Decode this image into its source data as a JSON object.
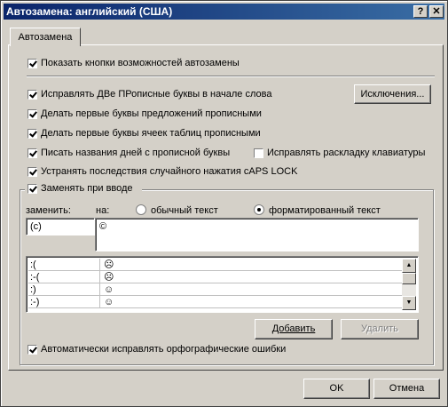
{
  "window": {
    "title": "Автозамена: английский (США)",
    "help_label": "?",
    "close_label": "✕"
  },
  "tabs": [
    {
      "label": "Автозамена",
      "selected": true
    }
  ],
  "options": {
    "show_buttons": {
      "label": "Показать кнопки возможностей автозамены",
      "checked": true
    },
    "two_initial_caps": {
      "label": "Исправлять ДВе ПРописные буквы в начале слова",
      "checked": true
    },
    "capitalize_sentences": {
      "label": "Делать первые буквы предложений прописными",
      "checked": true
    },
    "capitalize_table_cells": {
      "label": "Делать первые буквы ячеек таблиц прописными",
      "checked": true
    },
    "capitalize_day_names": {
      "label": "Писать названия дней с прописной буквы",
      "checked": true
    },
    "fix_keyboard_layout": {
      "label": "Исправлять раскладку клавиатуры",
      "checked": false
    },
    "caps_lock": {
      "label": "Устранять последствия случайного нажатия cAPS LOCK",
      "checked": true
    },
    "replace_as_you_type": {
      "label": "Заменять при вводе",
      "checked": true
    },
    "auto_spelling": {
      "label": "Автоматически исправлять орфографические ошибки",
      "checked": true
    }
  },
  "exceptions_button": "Исключения...",
  "replace": {
    "replace_label": "заменить:",
    "with_label": "на:",
    "plain_text_label": "обычный текст",
    "formatted_text_label": "форматированный текст",
    "format_mode": "formatted",
    "replace_value": "(c)",
    "with_value": "©"
  },
  "entries": [
    {
      "from": ":(",
      "to": "☹"
    },
    {
      "from": ":-(",
      "to": "☹"
    },
    {
      "from": ":)",
      "to": "☺"
    },
    {
      "from": ":-)",
      "to": "☺"
    }
  ],
  "buttons": {
    "add": "Добавить",
    "delete": "Удалить",
    "ok": "OK",
    "cancel": "Отмена"
  },
  "colors": {
    "title_bar_start": "#0a246a",
    "title_bar_end": "#3a6ea5",
    "dialog_bg": "#d4d0c8"
  },
  "icons": {
    "scroll_up": "triangle-up",
    "scroll_down": "triangle-down"
  }
}
